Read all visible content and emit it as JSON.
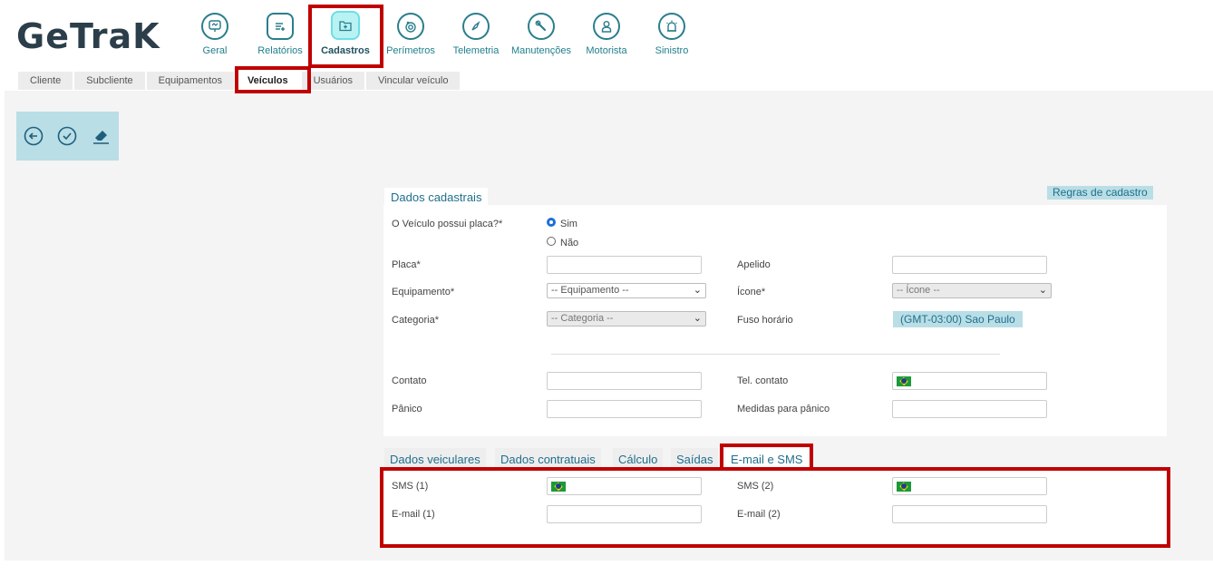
{
  "brand": {
    "logo_text": "GeTraK"
  },
  "nav": {
    "items": [
      {
        "label": "Geral",
        "icon": "monitor-icon"
      },
      {
        "label": "Relatórios",
        "icon": "report-icon"
      },
      {
        "label": "Cadastros",
        "icon": "folder-plus-icon",
        "active": true
      },
      {
        "label": "Perímetros",
        "icon": "target-icon"
      },
      {
        "label": "Telemetria",
        "icon": "compass-icon"
      },
      {
        "label": "Manutenções",
        "icon": "wrench-icon"
      },
      {
        "label": "Motorista",
        "icon": "driver-icon"
      },
      {
        "label": "Sinistro",
        "icon": "siren-icon"
      }
    ]
  },
  "subtabs": [
    "Cliente",
    "Subcliente",
    "Equipamentos",
    "Veículos",
    "Usuários",
    "Vincular veículo"
  ],
  "subtab_active": "Veículos",
  "section": {
    "title": "Dados cadastrais",
    "rules_button": "Regras de cadastro",
    "placa_question": "O Veículo possui placa?*",
    "radio_yes": "Sim",
    "radio_no": "Não",
    "placa_label": "Placa*",
    "apelido_label": "Apelido",
    "equipamento_label": "Equipamento*",
    "equipamento_value": "-- Equipamento --",
    "icone_label": "Ícone*",
    "icone_value": "-- Ícone --",
    "categoria_label": "Categoria*",
    "categoria_value": "-- Categoria --",
    "fuso_label": "Fuso horário",
    "fuso_value": "(GMT-03:00) Sao Paulo",
    "contato_label": "Contato",
    "tel_contato_label": "Tel. contato",
    "panico_label": "Pânico",
    "medidas_label": "Medidas para pânico"
  },
  "bottom_tabs": [
    "Dados veiculares",
    "Dados contratuais",
    "Cálculo",
    "Saídas",
    "E-mail e SMS"
  ],
  "bottom_tab_active": "E-mail e SMS",
  "email_sms": {
    "sms1_label": "SMS (1)",
    "sms2_label": "SMS (2)",
    "email1_label": "E-mail (1)",
    "email2_label": "E-mail (2)"
  },
  "colors": {
    "accent": "#1f7f8c",
    "highlight": "#c00000",
    "toolbar_bg": "#b9dee6"
  }
}
